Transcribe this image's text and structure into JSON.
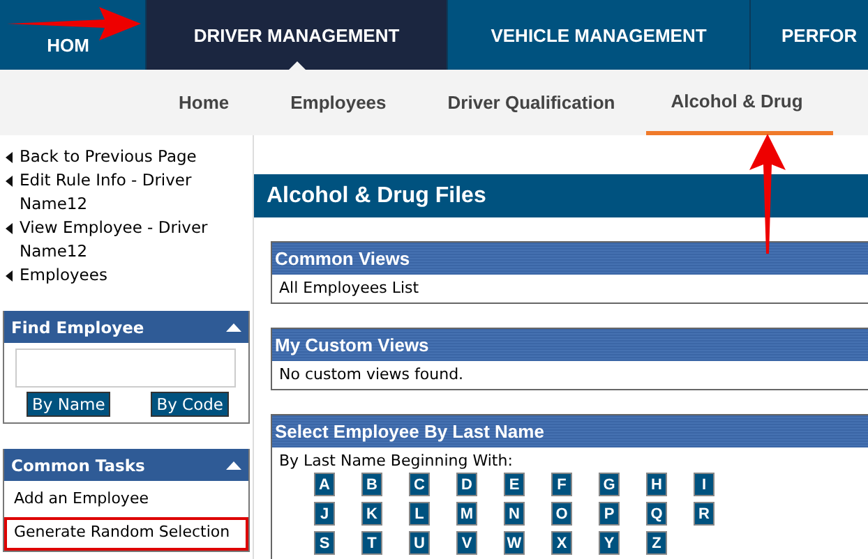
{
  "top_nav": [
    {
      "label": "HOM",
      "selected": false
    },
    {
      "label": "DRIVER MANAGEMENT",
      "selected": true
    },
    {
      "label": "VEHICLE MANAGEMENT",
      "selected": false
    },
    {
      "label": "PERFOR",
      "selected": false
    }
  ],
  "sub_nav": [
    {
      "label": "Home",
      "selected": false
    },
    {
      "label": "Employees",
      "selected": false
    },
    {
      "label": "Driver Qualification",
      "selected": false
    },
    {
      "label": "Alcohol & Drug",
      "selected": true
    }
  ],
  "breadcrumbs": [
    "Back to Previous Page",
    "Edit Rule Info - Driver Name12",
    "View Employee - Driver Name12",
    "Employees"
  ],
  "find_employee": {
    "title": "Find Employee",
    "buttons": [
      "By Name",
      "By Code"
    ]
  },
  "common_tasks": {
    "title": "Common Tasks",
    "items": [
      {
        "label": "Add an Employee",
        "highlighted": false
      },
      {
        "label": "Generate Random Selection",
        "highlighted": true
      }
    ]
  },
  "page_title": "Alcohol & Drug Files",
  "common_views": {
    "title": "Common Views",
    "items": [
      "All Employees List"
    ]
  },
  "custom_views": {
    "title": "My Custom Views",
    "message": "No custom views found."
  },
  "select_by_last_name": {
    "title": "Select Employee By Last Name",
    "prompt": "By Last Name Beginning With:",
    "letters": [
      [
        "A",
        "B",
        "C",
        "D",
        "E",
        "F",
        "G",
        "H",
        "I"
      ],
      [
        "J",
        "K",
        "L",
        "M",
        "N",
        "O",
        "P",
        "Q",
        "R"
      ],
      [
        "S",
        "T",
        "U",
        "V",
        "W",
        "X",
        "Y",
        "Z"
      ]
    ]
  }
}
